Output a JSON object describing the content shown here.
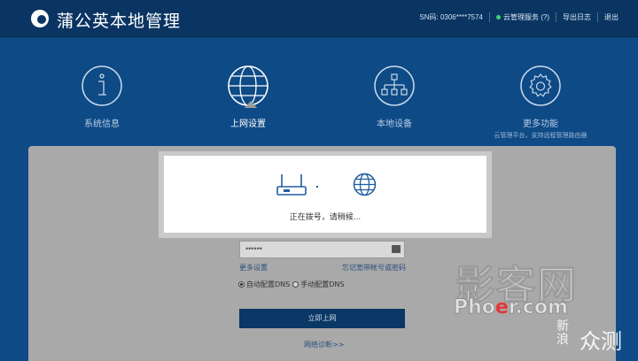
{
  "header": {
    "title": "蒲公英本地管理",
    "sn_label": "SN码: 0306****7574",
    "cloud_service": "云管理服务 (?)",
    "export_log": "导出日志",
    "logout": "退出",
    "cloud_status_color": "#3dd36a"
  },
  "nav": {
    "items": [
      {
        "label": "系统信息",
        "icon": "info-icon"
      },
      {
        "label": "上网设置",
        "icon": "globe-icon",
        "active": true
      },
      {
        "label": "本地设备",
        "icon": "network-tree-icon"
      },
      {
        "label": "更多功能",
        "icon": "gear-icon",
        "sublabel": "云管理平台，支持远程管理路由器"
      }
    ]
  },
  "form": {
    "password_value": "••••••",
    "more_settings": "更多设置",
    "forgot_account": "忘记宽带帐号或密码",
    "dns_auto": "自动配置DNS",
    "dns_manual": "手动配置DNS",
    "connect_button": "立即上网",
    "diagnose_link": "网络诊断>>"
  },
  "dialog": {
    "message": "正在拨号，请稍候..."
  },
  "watermark": {
    "main": "影客网",
    "url_pre": "Pho",
    "url_o": "e",
    "url_post": "r.com",
    "brand_a": "新浪",
    "brand_b": "众测"
  },
  "colors": {
    "header_bg": "#0a3562",
    "hero_bg": "#0e4a86",
    "accent": "#1f5ea0"
  }
}
